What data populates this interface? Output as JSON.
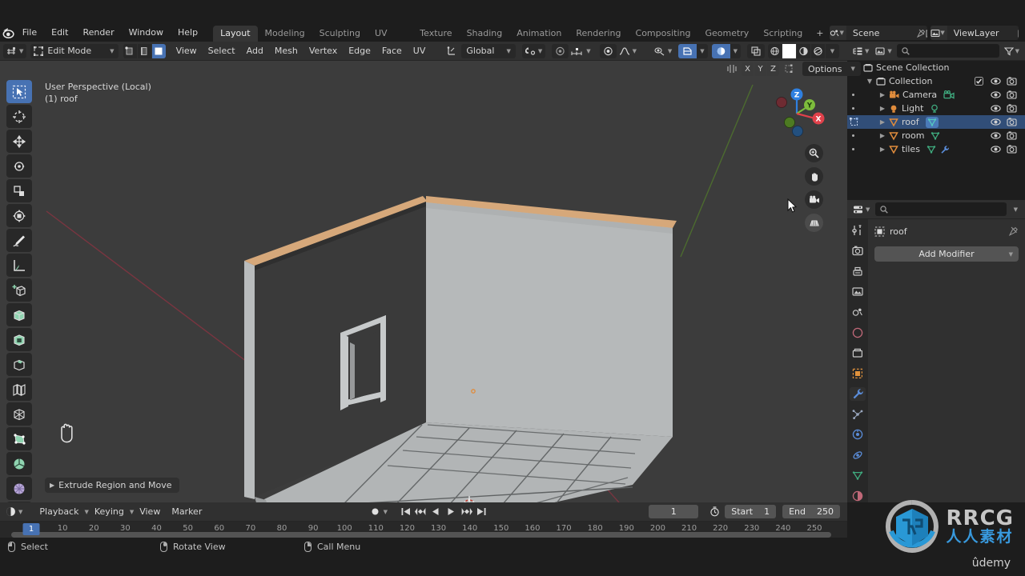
{
  "app": {
    "logo": "blender-logo"
  },
  "topbar": {
    "menus": [
      "File",
      "Edit",
      "Render",
      "Window",
      "Help"
    ],
    "workspaces": [
      {
        "label": "Layout",
        "active": true
      },
      {
        "label": "Modeling",
        "active": false
      },
      {
        "label": "Sculpting",
        "active": false
      },
      {
        "label": "UV Editing",
        "active": false
      },
      {
        "label": "Texture Paint",
        "active": false
      },
      {
        "label": "Shading",
        "active": false
      },
      {
        "label": "Animation",
        "active": false
      },
      {
        "label": "Rendering",
        "active": false
      },
      {
        "label": "Compositing",
        "active": false
      },
      {
        "label": "Geometry Nodes",
        "active": false
      },
      {
        "label": "Scripting",
        "active": false
      }
    ],
    "add_workspace": "+",
    "scene_name": "Scene",
    "view_layer_name": "ViewLayer"
  },
  "viewport_header": {
    "mode": "Edit Mode",
    "select_modes": [
      "vertex-select",
      "edge-select",
      "face-select"
    ],
    "active_select_mode": "face-select",
    "menus": [
      "View",
      "Select",
      "Add",
      "Mesh",
      "Vertex",
      "Edge",
      "Face",
      "UV"
    ],
    "transform_orientation": "Global",
    "proportional_edit": "off",
    "snap": "off",
    "options_label": "Options",
    "mirror_axes": [
      "X",
      "Y",
      "Z"
    ],
    "shading_modes": [
      "wireframe",
      "solid",
      "material-preview",
      "rendered"
    ],
    "active_shading_mode": "solid"
  },
  "viewport": {
    "perspective_text": "User Perspective (Local)",
    "object_text": "(1) roof",
    "operator_panel": "Extrude Region and Move",
    "gizmo_axes": [
      {
        "label": "Z",
        "color": "#2f80e0"
      },
      {
        "label": "Y",
        "color": "#7dbc3c"
      },
      {
        "label": "X",
        "color": "#e0414b"
      }
    ],
    "nav_buttons": [
      "zoom-icon",
      "pan-icon",
      "camera-view-icon",
      "toggle-orthographic-icon"
    ],
    "tools": [
      {
        "name": "tweak-select-box",
        "active": true
      },
      {
        "name": "cursor",
        "active": false
      },
      {
        "name": "move",
        "active": false
      },
      {
        "name": "rotate",
        "active": false
      },
      {
        "name": "scale",
        "active": false
      },
      {
        "name": "transform",
        "active": false
      },
      {
        "name": "annotate",
        "active": false
      },
      {
        "name": "measure",
        "active": false
      },
      {
        "name": "add-cube",
        "active": false
      },
      {
        "name": "extrude-region",
        "active": false
      },
      {
        "name": "inset-faces",
        "active": false
      },
      {
        "name": "bevel",
        "active": false
      },
      {
        "name": "loop-cut",
        "active": false
      },
      {
        "name": "knife",
        "active": false
      },
      {
        "name": "poly-build",
        "active": false
      },
      {
        "name": "spin",
        "active": false
      },
      {
        "name": "smooth",
        "active": false
      },
      {
        "name": "shrink-fatten",
        "active": false
      }
    ]
  },
  "outliner": {
    "search_placeholder": "",
    "rows": [
      {
        "label": "Scene Collection",
        "indent": 0,
        "icon": "scene-collection-icon",
        "icon_color": "#c8c8c8",
        "selected": false,
        "has_disclosure": false,
        "checkbox": false,
        "eye": false,
        "camera": false
      },
      {
        "label": "Collection",
        "indent": 1,
        "icon": "collection-icon",
        "icon_color": "#c8c8c8",
        "selected": false,
        "has_disclosure": true,
        "expanded": true,
        "checkbox": true,
        "eye": true,
        "camera": true
      },
      {
        "label": "Camera",
        "indent": 2,
        "icon": "camera-object-icon",
        "icon_color": "#e08c3c",
        "selected": false,
        "has_disclosure": true,
        "expanded": false,
        "checkbox": false,
        "eye": true,
        "camera": true,
        "data_icon": "camera-data-icon",
        "data_color": "#3faa7e"
      },
      {
        "label": "Light",
        "indent": 2,
        "icon": "light-object-icon",
        "icon_color": "#e08c3c",
        "selected": false,
        "has_disclosure": true,
        "expanded": false,
        "checkbox": false,
        "eye": true,
        "camera": true,
        "data_icon": "light-data-icon",
        "data_color": "#3faa7e"
      },
      {
        "label": "roof",
        "indent": 2,
        "icon": "mesh-object-icon",
        "icon_color": "#e08c3c",
        "selected": true,
        "has_disclosure": true,
        "expanded": false,
        "checkbox": false,
        "eye": true,
        "camera": true,
        "data_icon": "mesh-data-icon",
        "data_color": "#54c7c0"
      },
      {
        "label": "room",
        "indent": 2,
        "icon": "mesh-object-icon",
        "icon_color": "#e08c3c",
        "selected": false,
        "has_disclosure": true,
        "expanded": false,
        "checkbox": false,
        "eye": true,
        "camera": true,
        "data_icon": "mesh-data-icon",
        "data_color": "#3faa7e"
      },
      {
        "label": "tiles",
        "indent": 2,
        "icon": "mesh-object-icon",
        "icon_color": "#e08c3c",
        "selected": false,
        "has_disclosure": true,
        "expanded": false,
        "checkbox": false,
        "eye": true,
        "camera": true,
        "data_icon": "mesh-data-icon",
        "data_color": "#3faa7e",
        "extra_icon": "modifier-icon",
        "extra_color": "#5a8cd8"
      }
    ]
  },
  "properties": {
    "search_placeholder": "",
    "breadcrumb_object": "roof",
    "add_modifier_label": "Add Modifier",
    "tabs": [
      {
        "name": "tool-properties-tab",
        "active": false,
        "color": "#c8c8c8"
      },
      {
        "name": "render-properties-tab",
        "active": false,
        "color": "#c8c8c8"
      },
      {
        "name": "output-properties-tab",
        "active": false,
        "color": "#c8c8c8"
      },
      {
        "name": "view-layer-properties-tab",
        "active": false,
        "color": "#c8c8c8"
      },
      {
        "name": "scene-properties-tab",
        "active": false,
        "color": "#c8c8c8"
      },
      {
        "name": "world-properties-tab",
        "active": false,
        "color": "#c06878"
      },
      {
        "name": "collection-properties-tab",
        "active": false,
        "color": "#c8c8c8"
      },
      {
        "name": "object-properties-tab",
        "active": false,
        "color": "#e0923c"
      },
      {
        "name": "modifier-properties-tab",
        "active": true,
        "color": "#5a8cd8"
      },
      {
        "name": "particle-properties-tab",
        "active": false,
        "color": "#9aa8c0"
      },
      {
        "name": "physics-properties-tab",
        "active": false,
        "color": "#5a8cd8"
      },
      {
        "name": "constraint-properties-tab",
        "active": false,
        "color": "#5a8cd8"
      },
      {
        "name": "object-data-properties-tab",
        "active": false,
        "color": "#3faa7e"
      },
      {
        "name": "material-properties-tab",
        "active": false,
        "color": "#c06878"
      }
    ]
  },
  "timeline": {
    "editor_type": "timeline-editor-icon",
    "menus": [
      "Playback",
      "Keying",
      "View",
      "Marker"
    ],
    "current_frame": "1",
    "start_label": "Start",
    "start_value": "1",
    "end_label": "End",
    "end_value": "250",
    "ticks": [
      "1",
      "10",
      "20",
      "30",
      "40",
      "50",
      "60",
      "70",
      "80",
      "90",
      "100",
      "110",
      "120",
      "130",
      "140",
      "150",
      "160",
      "170",
      "180",
      "190",
      "200",
      "210",
      "220",
      "230",
      "240",
      "250"
    ],
    "playhead_frame": "1"
  },
  "statusbar": {
    "hints": [
      {
        "mouse": "left",
        "label": "Select"
      },
      {
        "mouse": "middle",
        "label": "Rotate View"
      },
      {
        "mouse": "right",
        "label": "Call Menu"
      }
    ]
  },
  "watermark": {
    "brand": "RRCG",
    "subtitle": "人人素材",
    "platform": "ûdemy"
  },
  "colors": {
    "accent_blue": "#4772b3",
    "selection_blue": "#314e78",
    "header_bg": "#303030",
    "viewport_bg": "#3c3c3c",
    "panel_bg": "#282828",
    "orange": "#e08c3c"
  }
}
